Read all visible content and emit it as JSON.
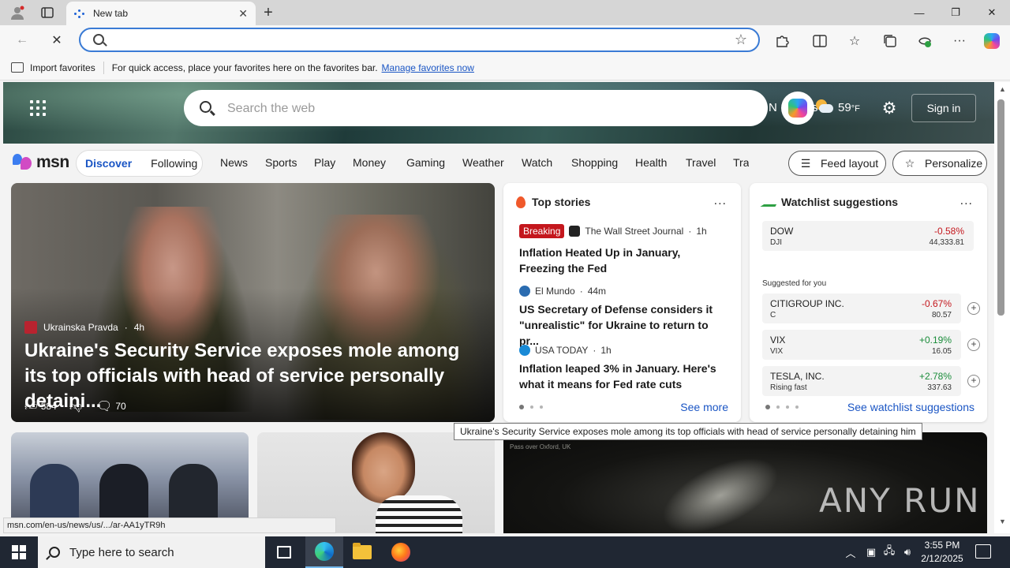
{
  "browser": {
    "tab_title": "New tab",
    "url_value": "",
    "favorites_bar": {
      "import_label": "Import favorites",
      "message": "For quick access, place your favorites here on the favorites bar.",
      "manage_link": "Manage favorites now"
    }
  },
  "msn": {
    "search_placeholder": "Search the web",
    "weather_partial": "N",
    "weather_partial_2": "ples",
    "temperature": "59",
    "temperature_unit": "°F",
    "sign_in": "Sign in",
    "logo_text": "msn",
    "discover": "Discover",
    "following": "Following",
    "nav_items": [
      "News",
      "Sports",
      "Play",
      "Money",
      "Gaming",
      "Weather",
      "Watch",
      "Shopping",
      "Health",
      "Travel",
      "Trai"
    ],
    "feed_layout": "Feed layout",
    "personalize": "Personalize",
    "hero": {
      "source": "Ukrainska Pravda",
      "age": "4h",
      "title": "Ukraine's Security Service exposes mole among its top officials with head of service personally detaini...",
      "likes": "584",
      "comments": "70"
    },
    "top_stories": {
      "heading": "Top stories",
      "more": "...",
      "stories": [
        {
          "badge": "Breaking",
          "source": "The Wall Street Journal",
          "age": "1h",
          "headline": "Inflation Heated Up in January, Freezing the Fed"
        },
        {
          "source": "El Mundo",
          "age": "44m",
          "headline": "US Secretary of Defense considers it \"unrealistic\" for Ukraine to return to pr..."
        },
        {
          "source": "USA TODAY",
          "age": "1h",
          "headline": "Inflation leaped 3% in January. Here's what it means for Fed rate cuts"
        }
      ],
      "see_more": "See more"
    },
    "watchlist": {
      "heading": "Watchlist suggestions",
      "more": "...",
      "suggested_label": "Suggested for you",
      "rows": [
        {
          "name": "DOW",
          "symbol": "DJI",
          "change": "-0.58%",
          "price": "44,333.81"
        },
        {
          "name": "CITIGROUP INC.",
          "symbol": "C",
          "change": "-0.67%",
          "price": "80.57"
        },
        {
          "name": "VIX",
          "symbol": "VIX",
          "change": "+0.19%",
          "price": "16.05"
        },
        {
          "name": "TESLA, INC.",
          "symbol": "Rising fast",
          "change": "+2.78%",
          "price": "337.63"
        }
      ],
      "see_link": "See watchlist suggestions"
    },
    "lower_caption": "Pass over Oxford, UK",
    "watermark": "ANY RUN"
  },
  "tooltip": "Ukraine's Security Service exposes mole among its top officials with head of service personally detaining him",
  "status_url": "msn.com/en-us/news/us/.../ar-AA1yTR9h",
  "taskbar": {
    "search_placeholder": "Type here to search",
    "time": "3:55 PM",
    "date": "2/12/2025"
  }
}
